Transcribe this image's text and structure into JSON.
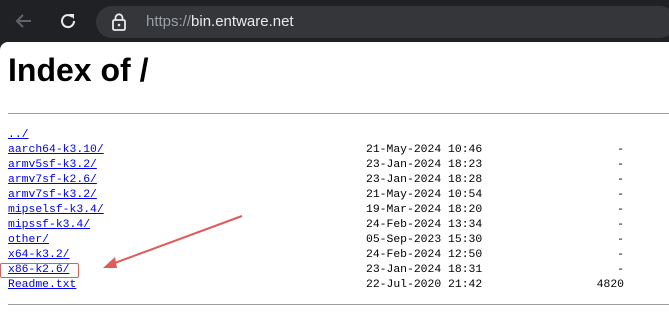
{
  "browser": {
    "url_scheme": "https://",
    "url_host": "bin.entware.net",
    "icons": [
      "back-arrow-icon",
      "reload-icon",
      "lock-icon"
    ]
  },
  "page": {
    "title": "Index of /",
    "entries": [
      {
        "name": "../",
        "date": "",
        "size": ""
      },
      {
        "name": "aarch64-k3.10/",
        "date": "21-May-2024 10:46",
        "size": "-"
      },
      {
        "name": "armv5sf-k3.2/",
        "date": "23-Jan-2024 18:23",
        "size": "-"
      },
      {
        "name": "armv7sf-k2.6/",
        "date": "23-Jan-2024 18:28",
        "size": "-"
      },
      {
        "name": "armv7sf-k3.2/",
        "date": "21-May-2024 10:54",
        "size": "-"
      },
      {
        "name": "mipselsf-k3.4/",
        "date": "19-Mar-2024 18:20",
        "size": "-"
      },
      {
        "name": "mipssf-k3.4/",
        "date": "24-Feb-2024 13:34",
        "size": "-"
      },
      {
        "name": "other/",
        "date": "05-Sep-2023 15:30",
        "size": "-"
      },
      {
        "name": "x64-k3.2/",
        "date": "24-Feb-2024 12:50",
        "size": "-"
      },
      {
        "name": "x86-k2.6/",
        "date": "23-Jan-2024 18:31",
        "size": "-"
      },
      {
        "name": "Readme.txt",
        "date": "22-Jul-2020 21:42",
        "size": "4820"
      }
    ],
    "annotation": {
      "highlighted_entry": "x86-k2.6/",
      "color": "#e05a5a"
    }
  }
}
